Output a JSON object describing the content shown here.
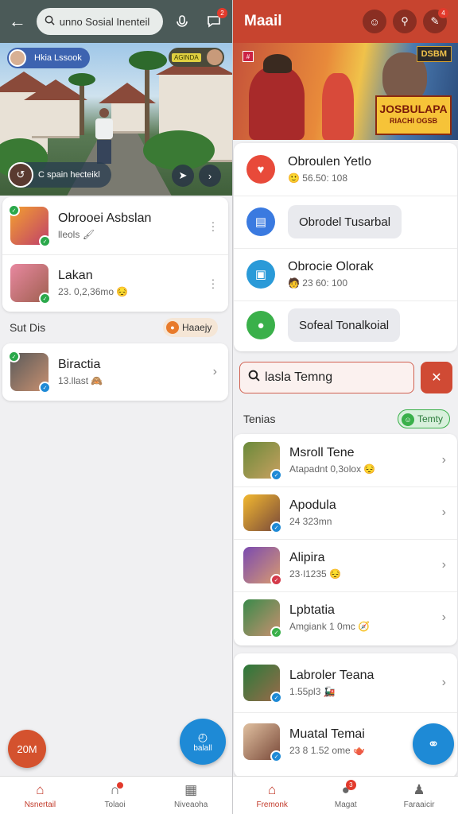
{
  "left": {
    "header": {
      "search_text": "unno Sosial Inenteil"
    },
    "hero": {
      "user_pill": "Hkia Lssook",
      "badge_tag": "AGINDA",
      "bottom_label": "C spain hecteikl"
    },
    "contacts": [
      {
        "name": "Obrooei Asbslan",
        "sub": "lleols",
        "emoji": "🖌"
      },
      {
        "name": "Lakan",
        "sub": "23. 0,2,36mo",
        "emoji": "😔"
      }
    ],
    "section": {
      "title": "Sut Dis",
      "chip": "Haaejy"
    },
    "contacts2": [
      {
        "name": "Biractia",
        "sub": "13.llast",
        "emoji": "🙈"
      }
    ],
    "fab_left": "20M",
    "fab_right": "balall",
    "nav": [
      {
        "label": "Nsnertail",
        "icon": "home-icon",
        "active": true
      },
      {
        "label": "Tolaoi",
        "icon": "calls-icon",
        "active": false
      },
      {
        "label": "Niveaoha",
        "icon": "calendar-icon",
        "active": false
      }
    ]
  },
  "right": {
    "header": {
      "title": "Maail",
      "badge": "4"
    },
    "banner": {
      "tag": "DSBM",
      "logo": "JOSBULAPA",
      "logo_sub": "RIACHI OGSB"
    },
    "menu": [
      {
        "label": "Obroulen Yetlo",
        "sub": "56.50: 108",
        "emoji": "🙂",
        "color": "#e84a3a",
        "icon": "heart-icon",
        "type": "text"
      },
      {
        "label": "Obrodel Tusarbal",
        "color": "#3a7ae0",
        "icon": "clipboard-icon",
        "type": "button"
      },
      {
        "label": "Obrocie Olorak",
        "sub": "23 60: 100",
        "emoji": "🧑",
        "color": "#2a9ad8",
        "icon": "photo-icon",
        "type": "text"
      },
      {
        "label": "Sofeal Tonalkoial",
        "color": "#3ab04a",
        "icon": "leaf-icon",
        "type": "button"
      }
    ],
    "search_text": "lasla Temng",
    "teams": {
      "title": "Tenias",
      "chip": "Temty"
    },
    "team_list": [
      {
        "name": "Msroll Tene",
        "sub": "Atapadnt 0,3olox",
        "emoji": "😔"
      },
      {
        "name": "Apodula",
        "sub": "24 323mn",
        "emoji": ""
      },
      {
        "name": "Alipira",
        "sub": "23·l1235",
        "emoji": "😔"
      },
      {
        "name": "Lpbtatia",
        "sub": "Amgiank 1 0mc",
        "emoji": "🧭"
      }
    ],
    "team_list2": [
      {
        "name": "Labroler Teana",
        "sub": "1.55pl3",
        "emoji": "🚂"
      },
      {
        "name": "Muatal Temai",
        "sub": "23 8 1.52 ome",
        "emoji": "🫖"
      }
    ],
    "nav": [
      {
        "label": "Fremonk",
        "icon": "home-icon",
        "active": true
      },
      {
        "label": "Magat",
        "icon": "chat-icon",
        "active": false,
        "badge": "3"
      },
      {
        "label": "Faraaicir",
        "icon": "profile-icon",
        "active": false
      }
    ]
  },
  "colors": {
    "left_header": "#4b5a58",
    "right_header": "#c7442f",
    "accent_red": "#c23a2a",
    "fab_blue": "#1e8ad6"
  }
}
